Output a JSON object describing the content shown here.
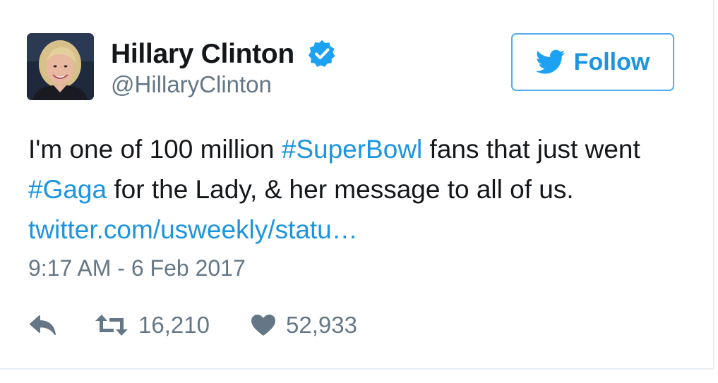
{
  "author": {
    "name": "Hillary Clinton",
    "handle": "@HillaryClinton",
    "verified": true,
    "avatar_icon": "profile-photo"
  },
  "follow_button": {
    "label": "Follow",
    "icon": "twitter-bird-icon"
  },
  "tweet": {
    "segments": [
      {
        "text": "I'm one of 100 million ",
        "type": "text"
      },
      {
        "text": "#SuperBowl",
        "type": "hashtag"
      },
      {
        "text": " fans that just went ",
        "type": "text"
      },
      {
        "text": "#Gaga",
        "type": "hashtag"
      },
      {
        "text": " for the Lady, & her message to all of us. ",
        "type": "text"
      },
      {
        "text": "twitter.com/usweekly/statu…",
        "type": "link"
      }
    ],
    "timestamp": "9:17 AM - 6 Feb 2017"
  },
  "actions": {
    "reply": {
      "icon": "reply-icon"
    },
    "retweet": {
      "icon": "retweet-icon",
      "count": "16,210"
    },
    "like": {
      "icon": "heart-icon",
      "count": "52,933"
    }
  },
  "colors": {
    "link": "#1b95e0",
    "follow_border": "#55acee",
    "muted": "#657786",
    "text": "#14171a",
    "verified": "#1da1f2"
  }
}
